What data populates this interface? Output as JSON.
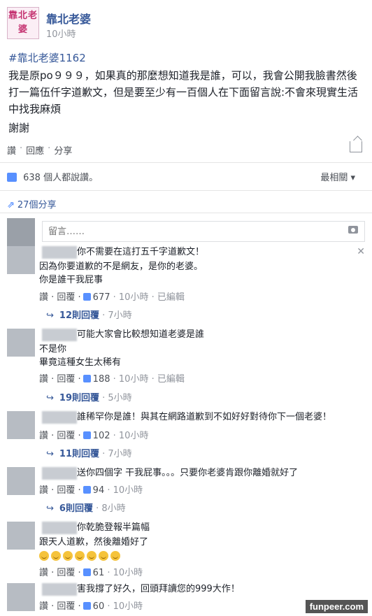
{
  "post": {
    "avatar_text": "靠北老婆",
    "page_name": "靠北老婆",
    "time": "10小時",
    "hashtag": "#靠北老婆1162",
    "body": "我是原po９９９，如果真的那麼想知道我是誰，可以，我會公開我臉書然後打一篇伍仟字道歉文，但是要至少有一百個人在下面留言說:不會來現實生活中找我麻煩",
    "thanks": "謝謝",
    "actions": [
      "讚",
      "回應",
      "分享"
    ]
  },
  "stats": {
    "likes_text": "638 個人都說讚。",
    "sort_label": "最相關",
    "shares_text": "27個分享"
  },
  "comment_box": {
    "placeholder": "留言……"
  },
  "comments": [
    {
      "lines": [
        "你不需要在這打五千字道歉文！",
        "因為你要道歉的不是網友，是你的老婆。",
        "你是誰干我屁事"
      ],
      "actions": "讚 · 回覆 ·",
      "likes": "677",
      "meta": "· 10小時 · 已編輯",
      "replies": "12則回覆",
      "reply_time": "· 7小時"
    },
    {
      "lines": [
        "可能大家會比較想知道老婆是誰",
        "不是你",
        "畢竟這種女生太稀有"
      ],
      "actions": "讚 · 回覆 ·",
      "likes": "188",
      "meta": "· 10小時 · 已編輯",
      "replies": "19則回覆",
      "reply_time": "· 5小時"
    },
    {
      "lines": [
        "誰稀罕你是誰！與其在網路道歉到不如好好對待你下一個老婆！"
      ],
      "actions": "讚 · 回覆 ·",
      "likes": "102",
      "meta": "· 10小時",
      "replies": "11則回覆",
      "reply_time": "· 7小時"
    },
    {
      "lines": [
        "送你四個字 干我屁事。。。只要你老婆肯跟你離婚就好了"
      ],
      "actions": "讚 · 回覆 ·",
      "likes": "94",
      "meta": "· 10小時",
      "replies": "6則回覆",
      "reply_time": "· 8小時"
    },
    {
      "lines": [
        "你乾脆登報半篇幅",
        "跟天人道歉，然後離婚好了"
      ],
      "emoji_count": 7,
      "actions": "讚 · 回覆 ·",
      "likes": "61",
      "meta": "· 10小時"
    },
    {
      "lines": [
        "害我撐了好久，回頭拜讀您的999大作！"
      ],
      "actions": "讚 · 回覆 ·",
      "likes": "60",
      "meta": "· 10小時"
    }
  ],
  "watermark": "funpeer.com"
}
